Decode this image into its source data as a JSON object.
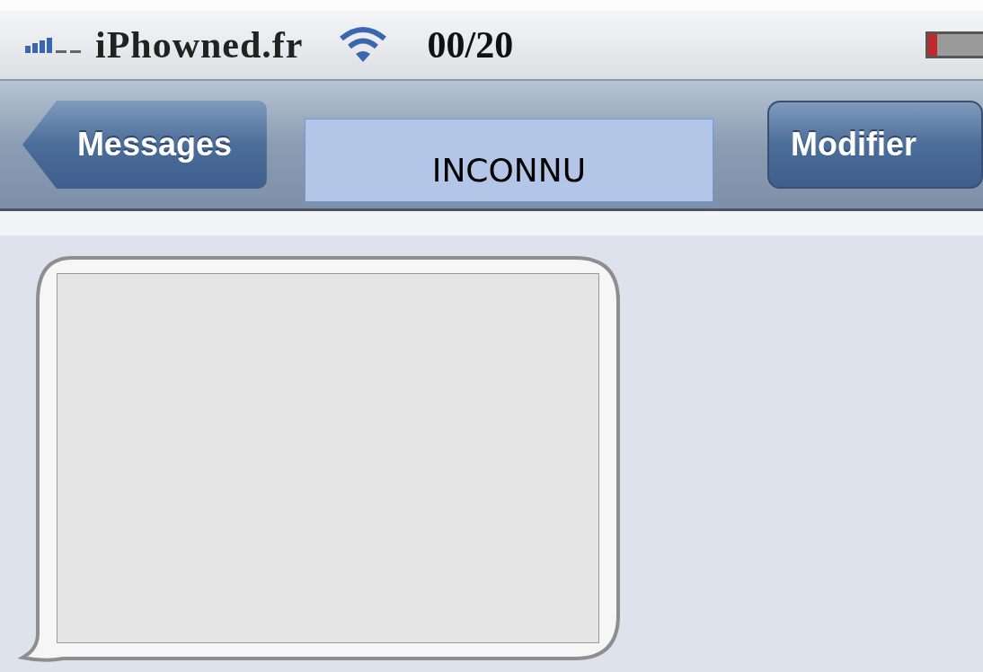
{
  "status_bar": {
    "carrier": "iPhowned.fr",
    "time": "00/20"
  },
  "nav_bar": {
    "back_button": "Messages",
    "title": "INCONNU",
    "right_button": "Modifier"
  },
  "messages": [
    {
      "kind": "received"
    }
  ]
}
